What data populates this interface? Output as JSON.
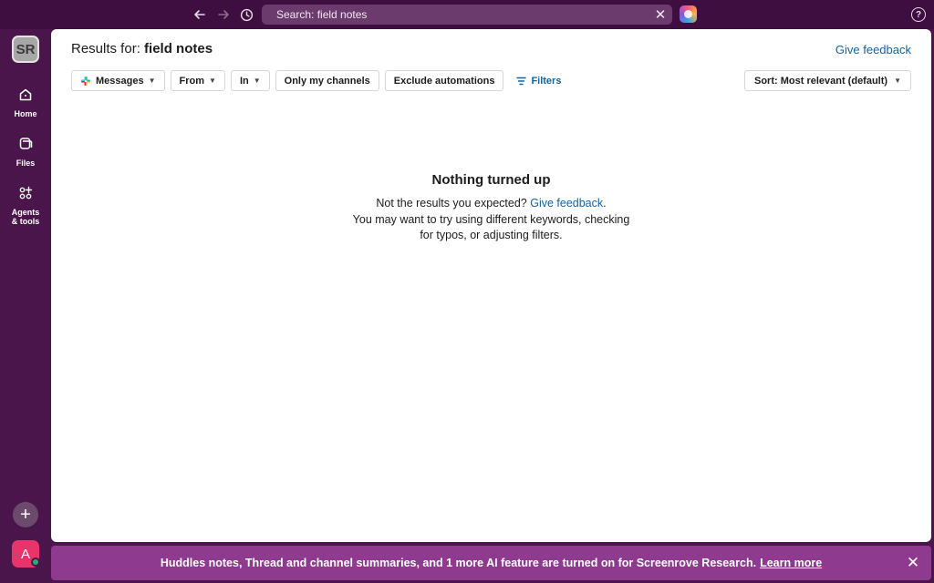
{
  "topbar": {
    "back_icon": "arrow-left-icon",
    "forward_icon": "arrow-right-icon",
    "history_icon": "clock-icon",
    "search_value": "Search: field notes",
    "clear_glyph": "✕",
    "help_glyph": "?"
  },
  "sidebar": {
    "workspace_initials": "SR",
    "items": [
      {
        "label": "Home",
        "icon": "home-icon"
      },
      {
        "label": "Files",
        "icon": "files-icon"
      },
      {
        "label_line1": "Agents",
        "label_line2": "& tools",
        "icon": "agents-tools-icon"
      }
    ],
    "add_glyph": "+",
    "user_initial": "A",
    "presence_color": "#2bac76"
  },
  "main": {
    "results_prefix": "Results for:",
    "query": "field notes",
    "give_feedback": "Give feedback",
    "filters": {
      "messages": "Messages",
      "from": "From",
      "in": "In",
      "only_my_channels": "Only my channels",
      "exclude_automations": "Exclude automations",
      "filters_link": "Filters"
    },
    "sort": "Sort: Most relevant (default)",
    "empty": {
      "title": "Nothing turned up",
      "line1_prefix": "Not the results you expected?",
      "line1_link": "Give feedback",
      "line1_suffix": ".",
      "line2": "You may want to try using different keywords, checking",
      "line3": "for typos, or adjusting filters."
    }
  },
  "banner": {
    "text": "Huddles notes, Thread and channel summaries, and 1 more AI feature are turned on for Screenrove Research.",
    "learn_more": "Learn more",
    "close_glyph": "✕"
  },
  "colors": {
    "sidebar_bg": "#4a154b",
    "topbar_bg": "#3f0e40",
    "link": "#1264a3",
    "banner_bg": "#8e3b8f",
    "user_avatar": "#e8336b"
  }
}
